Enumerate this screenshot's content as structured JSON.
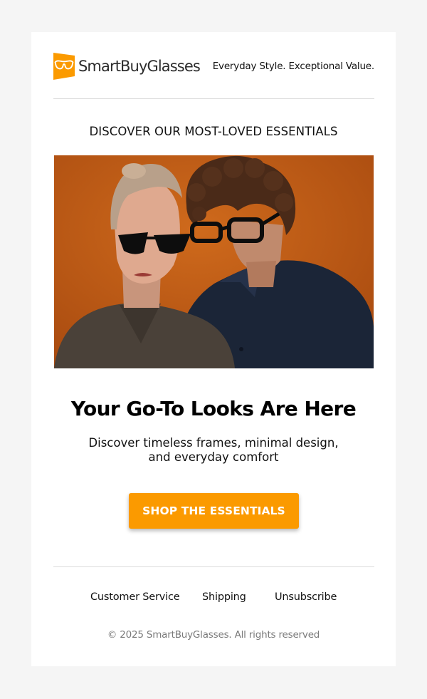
{
  "header": {
    "brand_name": "SmartBuyGlasses",
    "logo_icon": "glasses-logo-icon",
    "tagline": "Everyday Style. Exceptional Value."
  },
  "section_title": "DISCOVER OUR MOST-LOVED ESSENTIALS",
  "hero": {
    "image": "photo of a woman in black cat-eye sunglasses and a curly-haired man in black eyeglasses against an orange background"
  },
  "headline": "Your Go-To Looks Are Here",
  "subtext": {
    "line1": "Discover timeless frames, minimal design,",
    "line2": "and everyday comfort"
  },
  "cta_label": "SHOP THE ESSENTIALS",
  "footer": {
    "links": [
      "Customer Service",
      "Shipping",
      "Unsubscribe"
    ],
    "copyright": "© 2025 SmartBuyGlasses. All rights reserved"
  },
  "colors": {
    "page_background": "#f5f5f5",
    "card_background": "#ffffff",
    "brand_orange": "#fb9a00",
    "hero_background": "#c05a14",
    "divider": "#dcdcdc",
    "muted_text": "#7a7a7a"
  }
}
